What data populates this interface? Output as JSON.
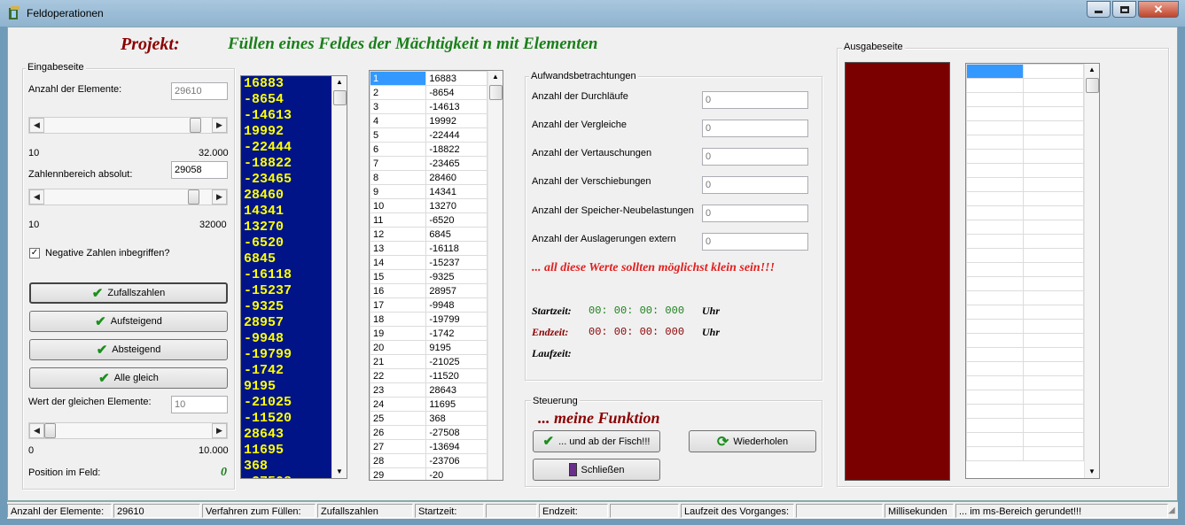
{
  "window": {
    "title": "Feldoperationen"
  },
  "header": {
    "projekt_label": "Projekt:",
    "projekt_title": "Füllen eines Feldes der Mächtigkeit n mit Elementen"
  },
  "eingabe": {
    "legend": "Eingabeseite",
    "anzahl_label": "Anzahl der Elemente:",
    "anzahl_value": "29610",
    "slider1_min": "10",
    "slider1_max": "32.000",
    "slider1_level_fraction": 0.92,
    "bereich_label": "Zahlennbereich absolut:",
    "bereich_value": "29058",
    "slider2_min": "10",
    "slider2_max": "32000",
    "slider2_level_fraction": 0.91,
    "negative_label": "Negative Zahlen inbegriffen?",
    "negative_checked": true,
    "btn_zufall": "Zufallszahlen",
    "btn_auf": "Aufsteigend",
    "btn_ab": "Absteigend",
    "btn_gleich": "Alle gleich",
    "gleich_label": "Wert der gleichen Elemente:",
    "gleich_value": "10",
    "slider3_min": "0",
    "slider3_max": "10.000",
    "slider3_level_fraction": 0.0,
    "position_label": "Position im Feld:",
    "position_value": "0"
  },
  "numbers": [
    "16883",
    "-8654",
    "-14613",
    "19992",
    "-22444",
    "-18822",
    "-23465",
    "28460",
    "14341",
    "13270",
    "-6520",
    "6845",
    "-16118",
    "-15237",
    "-9325",
    "28957",
    "-9948",
    "-19799",
    "-1742",
    "9195",
    "-21025",
    "-11520",
    "28643",
    "11695",
    "368",
    "-27508"
  ],
  "table": {
    "rows": [
      [
        "1",
        "16883"
      ],
      [
        "2",
        "-8654"
      ],
      [
        "3",
        "-14613"
      ],
      [
        "4",
        "19992"
      ],
      [
        "5",
        "-22444"
      ],
      [
        "6",
        "-18822"
      ],
      [
        "7",
        "-23465"
      ],
      [
        "8",
        "28460"
      ],
      [
        "9",
        "14341"
      ],
      [
        "10",
        "13270"
      ],
      [
        "11",
        "-6520"
      ],
      [
        "12",
        "6845"
      ],
      [
        "13",
        "-16118"
      ],
      [
        "14",
        "-15237"
      ],
      [
        "15",
        "-9325"
      ],
      [
        "16",
        "28957"
      ],
      [
        "17",
        "-9948"
      ],
      [
        "18",
        "-19799"
      ],
      [
        "19",
        "-1742"
      ],
      [
        "20",
        "9195"
      ],
      [
        "21",
        "-21025"
      ],
      [
        "22",
        "-11520"
      ],
      [
        "23",
        "28643"
      ],
      [
        "24",
        "11695"
      ],
      [
        "25",
        "368"
      ],
      [
        "26",
        "-27508"
      ],
      [
        "27",
        "-13694"
      ],
      [
        "28",
        "-23706"
      ],
      [
        "29",
        "-20"
      ]
    ]
  },
  "aufwand": {
    "legend": "Aufwandsbetrachtungen",
    "rows": [
      {
        "label": "Anzahl der Durchläufe",
        "value": "0"
      },
      {
        "label": "Anzahl der Vergleiche",
        "value": "0"
      },
      {
        "label": "Anzahl der Vertauschungen",
        "value": "0"
      },
      {
        "label": "Anzahl der Verschiebungen",
        "value": "0"
      },
      {
        "label": "Anzahl der Speicher-Neubelastungen",
        "value": "0"
      },
      {
        "label": "Anzahl der Auslagerungen extern",
        "value": "0"
      }
    ],
    "hinweis": "... all diese Werte sollten möglichst klein sein!!!",
    "start_label": "Startzeit:",
    "start_value": "00: 00: 00: 000",
    "end_label": "Endzeit:",
    "end_value": "00: 00: 00: 000",
    "uhr": "Uhr",
    "lauf_label": "Laufzeit:"
  },
  "steuerung": {
    "legend": "Steuerung",
    "funktion": "... meine Funktion",
    "btn_fisch": "... und ab der Fisch!!!",
    "btn_wiederholen": "Wiederholen",
    "btn_schliessen": "Schließen"
  },
  "ausgabe": {
    "legend": "Ausgabeseite",
    "panel_color": "#7a0000"
  },
  "status": {
    "anzahl_label": "Anzahl der Elemente:",
    "anzahl_value": "29610",
    "verfahren_label": "Verfahren zum Füllen:",
    "verfahren_value": "Zufallszahlen",
    "start_label": "Startzeit:",
    "start_value": "",
    "end_label": "Endzeit:",
    "end_value": "",
    "lauf_label": "Laufzeit des Vorganges:",
    "lauf_value": "",
    "ms_label": "Millisekunden",
    "note": "... im ms-Bereich gerundet!!!"
  },
  "colors": {
    "accent_green": "#1a7f1a",
    "accent_red": "#8b0000",
    "list_bg": "#001488",
    "list_fg": "#ffff00",
    "hinweis_red": "#e02020"
  }
}
